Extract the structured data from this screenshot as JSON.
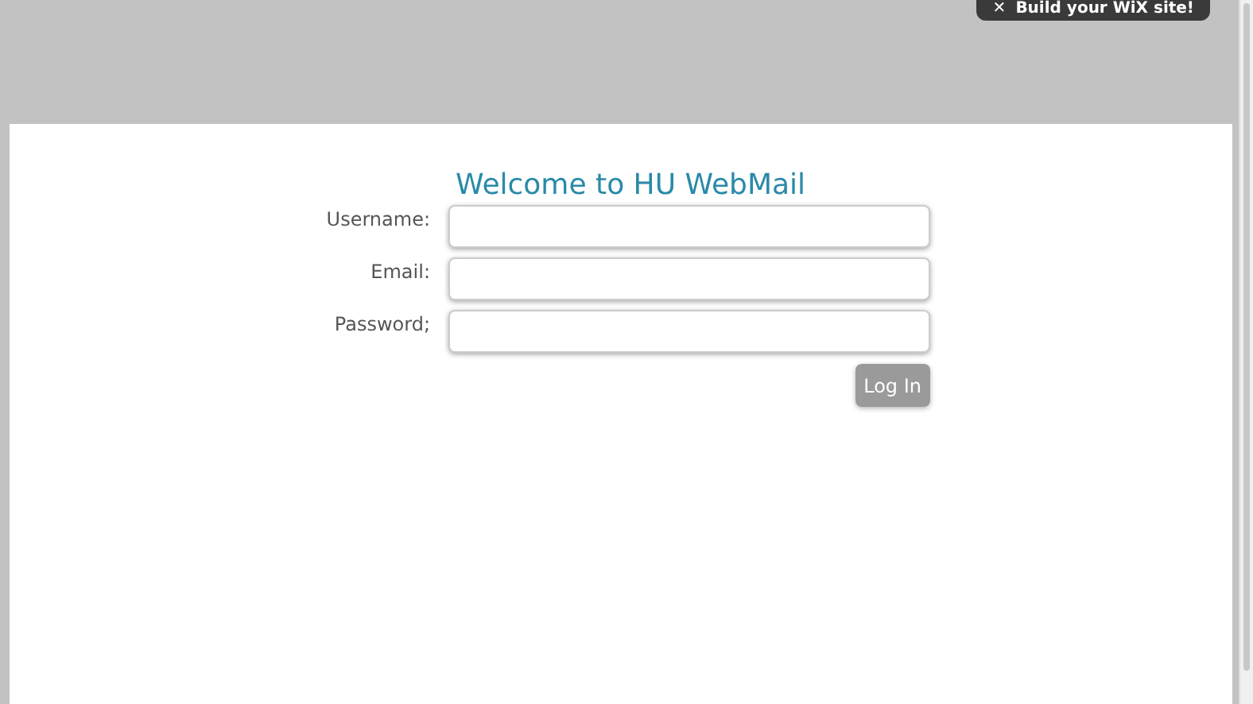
{
  "banner": {
    "icon": "✕",
    "text": "Build your WiX site!"
  },
  "login": {
    "title": "Welcome to HU WebMail",
    "fields": [
      {
        "label": "Username:"
      },
      {
        "label": "Email:"
      },
      {
        "label": "Password;"
      }
    ],
    "button": "Log In"
  }
}
